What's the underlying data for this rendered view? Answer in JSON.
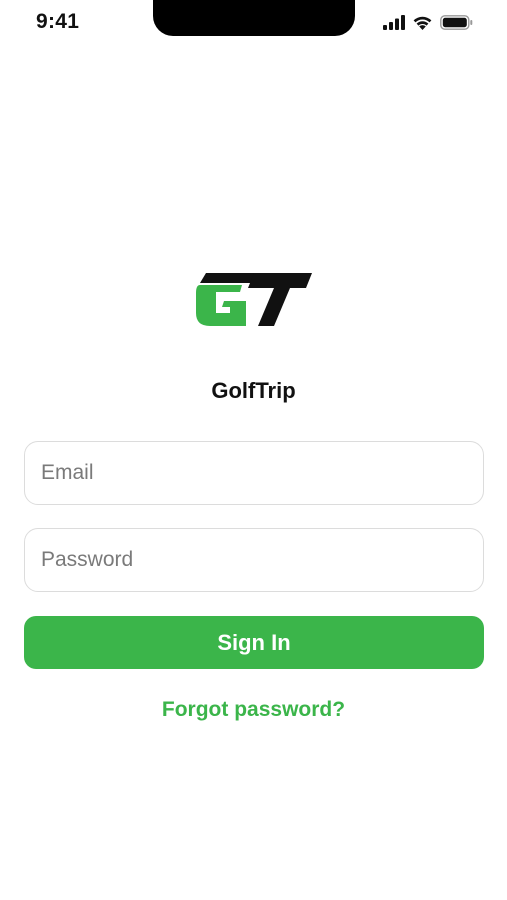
{
  "status_bar": {
    "time": "9:41",
    "icons": [
      "signal-icon",
      "wifi-icon",
      "battery-icon"
    ]
  },
  "app": {
    "logo_text": "GT",
    "name": "GolfTrip"
  },
  "form": {
    "email_placeholder": "Email",
    "email_value": "",
    "password_placeholder": "Password",
    "password_value": "",
    "sign_in_label": "Sign In",
    "forgot_password_label": "Forgot password?"
  },
  "colors": {
    "brand_green": "#3bb54a",
    "logo_black": "#111111",
    "field_border": "#dcdcdc",
    "placeholder": "#7a7a7a"
  }
}
